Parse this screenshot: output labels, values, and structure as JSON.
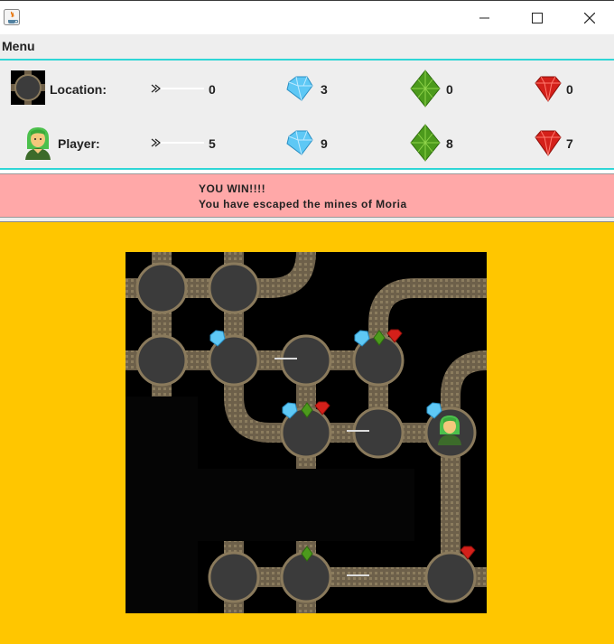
{
  "window": {
    "title": ""
  },
  "menu": {
    "label": "Menu"
  },
  "location": {
    "label": "Location:",
    "arrows": "0",
    "diamonds": "3",
    "emeralds": "0",
    "rubies": "0"
  },
  "player": {
    "label": "Player:",
    "arrows": "5",
    "diamonds": "9",
    "emeralds": "8",
    "rubies": "7"
  },
  "message": {
    "line1": "YOU WIN!!!!",
    "line2": "You have escaped the mines of Moria"
  },
  "colors": {
    "game_bg": "#ffc600",
    "message_bg": "#ffa8a8",
    "accent_line": "#2ed6d6",
    "board_bg": "#000000"
  },
  "icons": [
    "java-icon",
    "minimize-icon",
    "maximize-icon",
    "close-icon",
    "cave-icon",
    "player-icon",
    "arrow-icon",
    "diamond-icon",
    "emerald-icon",
    "ruby-icon"
  ]
}
